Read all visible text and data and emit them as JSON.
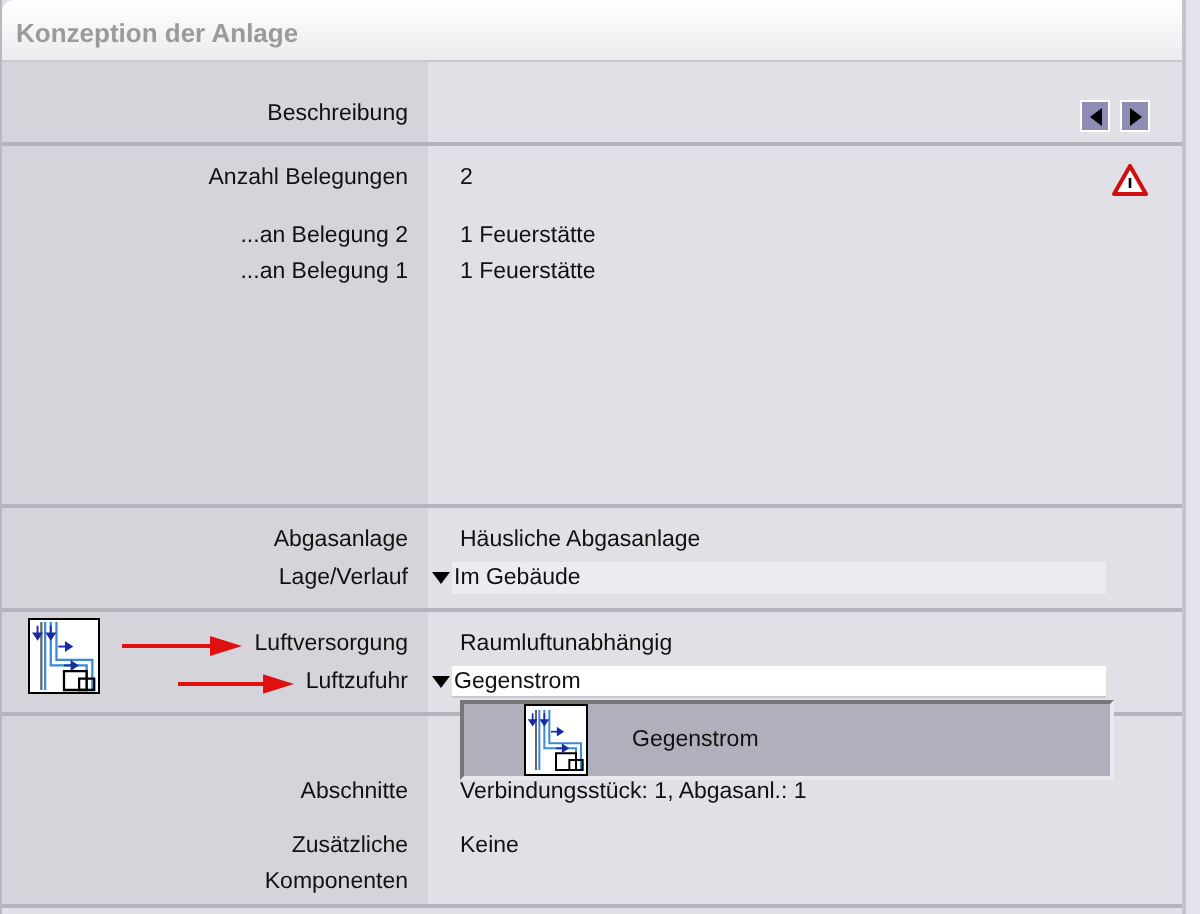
{
  "window": {
    "title": "Konzeption der Anlage"
  },
  "sections": [
    {
      "rows": [
        {
          "kind": "nav",
          "label": "Beschreibung"
        }
      ]
    },
    {
      "rows": [
        {
          "kind": "warning",
          "label": "Anzahl Belegungen",
          "value": "2"
        },
        {
          "kind": "text",
          "label": "...an Belegung 2",
          "value": "1 Feuerstätte"
        },
        {
          "kind": "text",
          "label": "...an Belegung 1",
          "value": "1 Feuerstätte"
        }
      ]
    },
    {
      "rows": [
        {
          "kind": "text",
          "label": "Abgasanlage",
          "value": "Häusliche Abgasanlage"
        },
        {
          "kind": "select",
          "label": "Lage/Verlauf",
          "value": "Im Gebäude",
          "expanded": false
        }
      ]
    },
    {
      "diagram": true,
      "rows": [
        {
          "kind": "text",
          "label": "Luftversorgung",
          "value": "Raumluftunabhängig",
          "arrow": true
        },
        {
          "kind": "select",
          "label": "Luftzufuhr",
          "value": "Gegenstrom",
          "arrow": true,
          "expanded": true,
          "options": [
            {
              "label": "Gegenstrom",
              "selected": true
            }
          ]
        }
      ]
    },
    {
      "rows": [
        {
          "kind": "text",
          "label": "Abschnitte",
          "value": "Verbindungsstück: 1, Abgasanl.: 1"
        },
        {
          "kind": "text",
          "label": "Zusätzliche Komponenten",
          "value": "Keine"
        }
      ]
    }
  ]
}
